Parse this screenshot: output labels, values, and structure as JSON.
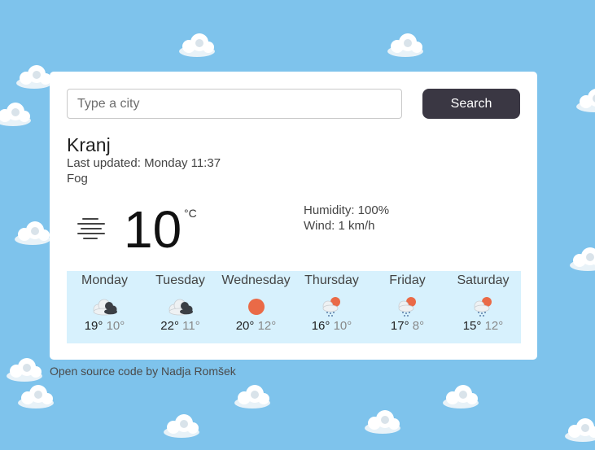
{
  "search": {
    "placeholder": "Type a city",
    "button_label": "Search"
  },
  "current": {
    "city": "Kranj",
    "last_updated": "Last updated: Monday 11:37",
    "description": "Fog",
    "icon": "fog-icon",
    "temperature": "10",
    "unit": "°C",
    "humidity": "Humidity: 100%",
    "wind": "Wind: 1 km/h"
  },
  "forecast": [
    {
      "day": "Monday",
      "icon": "cloudy-icon",
      "max": "19°",
      "min": "10°"
    },
    {
      "day": "Tuesday",
      "icon": "cloudy-icon",
      "max": "22°",
      "min": "11°"
    },
    {
      "day": "Wednesday",
      "icon": "sun-icon",
      "max": "20°",
      "min": "12°"
    },
    {
      "day": "Thursday",
      "icon": "sun-rain-icon",
      "max": "16°",
      "min": "10°"
    },
    {
      "day": "Friday",
      "icon": "sun-rain-icon",
      "max": "17°",
      "min": "8°"
    },
    {
      "day": "Saturday",
      "icon": "sun-rain-icon",
      "max": "15°",
      "min": "12°"
    }
  ],
  "footer": "Open source code by Nadja Romšek",
  "colors": {
    "background": "#7ec3ec",
    "button": "#3a3743",
    "forecast_bg": "#d7f1fd",
    "sun": "#ea6a47"
  }
}
